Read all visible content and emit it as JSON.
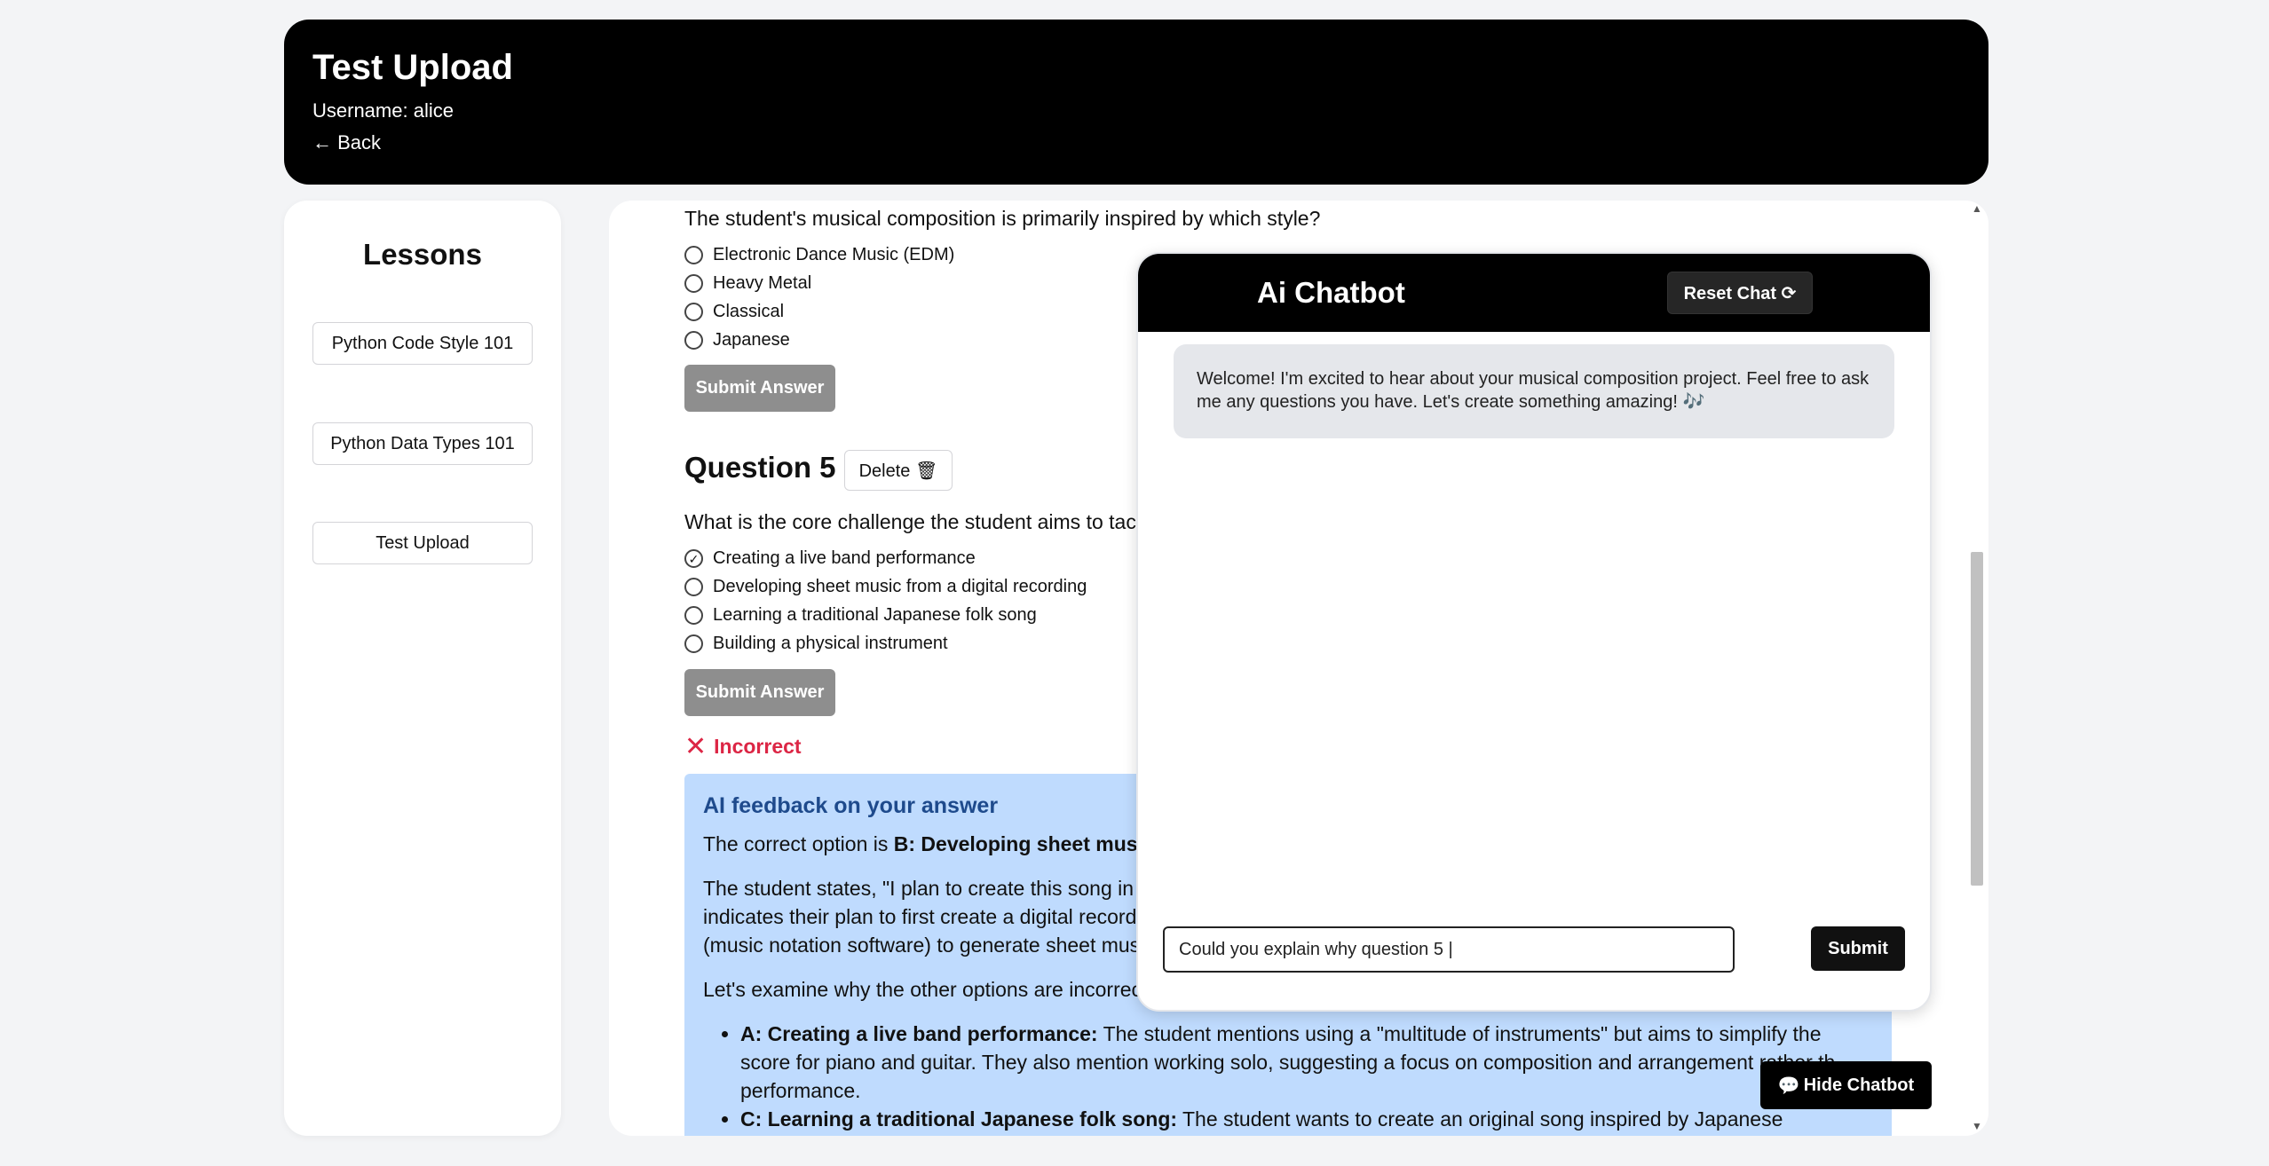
{
  "header": {
    "title": "Test Upload",
    "username": "Username: alice",
    "back": "← Back"
  },
  "sidebar": {
    "title": "Lessons",
    "items": [
      {
        "label": "Python Code Style 101"
      },
      {
        "label": "Python Data Types 101"
      },
      {
        "label": "Test Upload"
      }
    ]
  },
  "question4": {
    "text": "The student's musical composition is primarily inspired by which style?",
    "options": [
      "Electronic Dance Music (EDM)",
      "Heavy Metal",
      "Classical",
      "Japanese"
    ],
    "submit": "Submit Answer"
  },
  "question5": {
    "heading": "Question 5",
    "delete": "Delete 🗑",
    "text": "What is the core challenge the student aims to tack",
    "options": [
      "Creating a live band performance",
      "Developing sheet music from a digital recording",
      "Learning a traditional Japanese folk song",
      "Building a physical instrument"
    ],
    "selected_mark": "✓",
    "submit": "Submit Answer",
    "result": "Incorrect",
    "result_icon": "✕"
  },
  "feedback": {
    "title": "AI feedback on your answer",
    "correct_prefix": "The correct option is ",
    "correct_bold": "B: Developing sheet music",
    "para1_line1": "The student states, \"I plan to create this song in r",
    "para1_line2": "indicates their plan to first create a digital recordi",
    "para1_line3": "(music notation software) to generate sheet musi",
    "para2": "Let's examine why the other options are incorrect",
    "bullet_a_bold": "A: Creating a live band performance:",
    "bullet_a_text": " The student mentions using a \"multitude of instruments\" but aims to simplify the score for piano and guitar. They also mention working solo, suggesting a focus on composition and arrangement rather th performance.",
    "bullet_c_bold": "C: Learning a traditional Japanese folk song:",
    "bullet_c_text": " The student wants to create an original song inspired by Japanese composition"
  },
  "chatbot": {
    "title": "Ai Chatbot",
    "reset": "Reset Chat ⟳",
    "welcome": "Welcome! I'm excited to hear about your musical composition project. Feel free to ask me any questions you have. Let's create something amazing! 🎶",
    "input_value": "Could you explain why question 5 |",
    "submit": "Submit",
    "hide": "Hide Chatbot",
    "hide_icon": "💬"
  },
  "colors": {
    "header_bg": "#000000",
    "feedback_bg": "#bfdbfe",
    "feedback_title": "#1e4a8c",
    "incorrect": "#dc2645",
    "submit_disabled": "#8e8e8e"
  }
}
